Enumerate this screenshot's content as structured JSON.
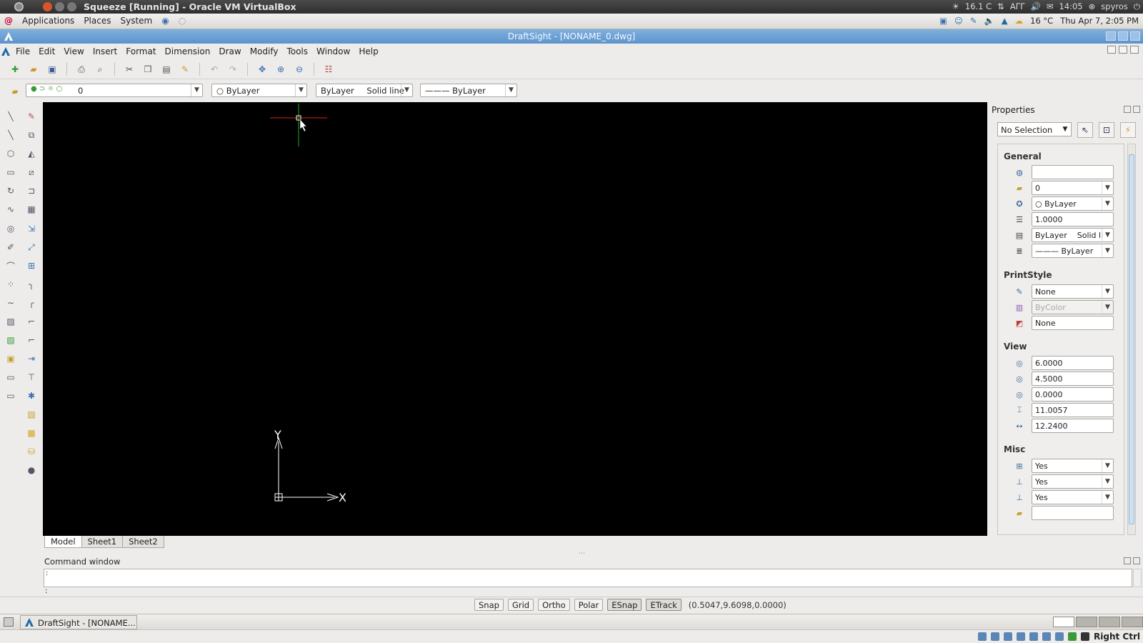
{
  "host": {
    "title": "Squeeze [Running] - Oracle VM VirtualBox",
    "tray": {
      "temperature": "16.1 C",
      "keyboard": "ΑΓΓ",
      "time": "14:05",
      "user": "spyros"
    }
  },
  "gnome_panel": {
    "menus": [
      "Applications",
      "Places",
      "System"
    ],
    "weather": "16 °C",
    "datetime": "Thu Apr 7, 2:05 PM"
  },
  "app": {
    "title": "DraftSight - [NONAME_0.dwg]",
    "menu": [
      "File",
      "Edit",
      "View",
      "Insert",
      "Format",
      "Dimension",
      "Draw",
      "Modify",
      "Tools",
      "Window",
      "Help"
    ]
  },
  "toolbar": {
    "layer_value": "0",
    "color_value": "ByLayer",
    "linestyle_value": "ByLayer",
    "linestyle_type": "Solid line",
    "lineweight_value": "ByLayer"
  },
  "canvas": {
    "background": "#000000",
    "ucs_x_label": "X",
    "ucs_y_label": "Y"
  },
  "sheets": [
    "Model",
    "Sheet1",
    "Sheet2"
  ],
  "properties": {
    "title": "Properties",
    "selection": "No Selection",
    "sections": {
      "general": "General",
      "printstyle": "PrintStyle",
      "view": "View",
      "misc": "Misc"
    },
    "general": {
      "color": "",
      "layer": "0",
      "color_value": "ByLayer",
      "scale": "1.0000",
      "linestyle": "ByLayer",
      "linestyle_type": "Solid li",
      "lineweight": "ByLayer"
    },
    "printstyle": {
      "style": "None",
      "table": "ByColor",
      "attached": "None"
    },
    "view": {
      "center_x": "6.0000",
      "center_y": "4.5000",
      "center_z": "0.0000",
      "height": "11.0057",
      "width": "12.2400"
    },
    "misc": {
      "ucs_on": "Yes",
      "ucs_origin": "Yes",
      "ucs_per_viewport": "Yes",
      "ucs_name": ""
    }
  },
  "command_window": {
    "title": "Command window",
    "output": ":",
    "prompt": ":"
  },
  "status": {
    "toggles": [
      {
        "label": "Snap",
        "on": false
      },
      {
        "label": "Grid",
        "on": false
      },
      {
        "label": "Ortho",
        "on": false
      },
      {
        "label": "Polar",
        "on": false
      },
      {
        "label": "ESnap",
        "on": true
      },
      {
        "label": "ETrack",
        "on": true
      }
    ],
    "coordinates": "(0.5047,9.6098,0.0000)"
  },
  "taskbar": {
    "item": "DraftSight - [NONAME..."
  },
  "vbox_status": {
    "host_key": "Right Ctrl"
  }
}
